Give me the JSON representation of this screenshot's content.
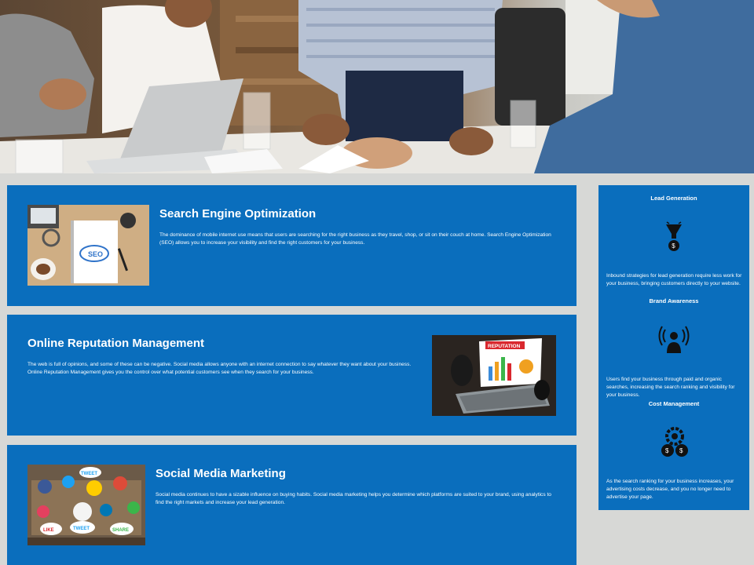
{
  "hero": {
    "icon": "business-meeting-photo"
  },
  "services": [
    {
      "title": "Search Engine Optimization",
      "body": "The dominance of mobile internet use means that users are searching for the right business as they travel, shop, or sit on their couch at home. Search Engine Optimization (SEO) allows you to increase your visibility and find the right customers for your business.",
      "image": "seo-notebook-photo",
      "image_text": "SEO"
    },
    {
      "title": "Online Reputation Management",
      "body": "The web is full of opinions, and some of these can be negative. Social media allows anyone with an internet connection to say whatever they want about your business. Online Reputation Management gives you the control over what potential customers see when they search for your business.",
      "image": "reputation-laptop-photo",
      "image_text": "REPUTATION"
    },
    {
      "title": "Social Media Marketing",
      "body": "Social media continues to have a sizable influence on buying habits. Social media marketing helps you determine which platforms are suited to your brand, using analytics to find the right markets and increase your lead generation.",
      "image": "social-media-icons-photo",
      "image_text": [
        "LIKE",
        "TWEET",
        "SHARE",
        "TWEET"
      ]
    }
  ],
  "sidebar": {
    "heading": "Lead Generation",
    "sections": [
      {
        "icon": "funnel-dollar-icon",
        "text": "Inbound strategies for lead generation require less work for your business, bringing customers directly to your website."
      },
      {
        "title": "Brand Awareness",
        "icon": "broadcasting-person-icon",
        "text": "Users find your business through paid and organic searches, increasing the search ranking and visibility for your business."
      },
      {
        "title": "Cost Management",
        "icon": "gears-dollar-icon",
        "text": "As the search ranking for your business increases, your advertising costs decrease, and you no longer need to advertise your page."
      }
    ]
  },
  "colors": {
    "panel_blue": "#0a6ebd",
    "page_bg": "#d7d8d6"
  }
}
